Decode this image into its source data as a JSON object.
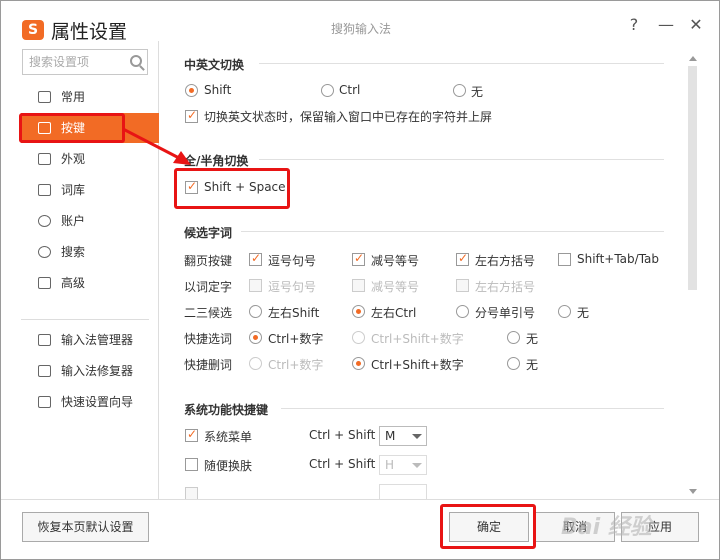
{
  "window": {
    "title": "属性设置",
    "app_name": "搜狗输入法",
    "help_label": "?",
    "minimize_label": "—",
    "close_label": "✕",
    "logo_text": "S"
  },
  "sidebar": {
    "search_placeholder": "搜索设置项",
    "items": [
      {
        "label": "常用",
        "icon": "monitor-icon"
      },
      {
        "label": "按键",
        "icon": "keyboard-icon",
        "active": true
      },
      {
        "label": "外观",
        "icon": "shirt-icon"
      },
      {
        "label": "词库",
        "icon": "dictionary-icon"
      },
      {
        "label": "账户",
        "icon": "user-icon"
      },
      {
        "label": "搜索",
        "icon": "search-icon"
      },
      {
        "label": "高级",
        "icon": "advanced-icon"
      }
    ],
    "tools": [
      {
        "label": "输入法管理器",
        "icon": "manager-icon"
      },
      {
        "label": "输入法修复器",
        "icon": "repair-icon"
      },
      {
        "label": "快速设置向导",
        "icon": "flag-icon"
      }
    ]
  },
  "main": {
    "cn_en_switch": {
      "title": "中英文切换",
      "options": [
        "Shift",
        "Ctrl",
        "无"
      ],
      "selected": "Shift",
      "keep_label": "切换英文状态时，保留输入窗口中已存在的字符并上屏"
    },
    "fullhalf": {
      "title": "全/半角切换",
      "shortcut_label": "Shift + Space"
    },
    "candidate": {
      "title": "候选字词",
      "rows": [
        {
          "label": "翻页按键",
          "items": [
            "逗号句号",
            "减号等号",
            "左右方括号",
            "Shift+Tab/Tab"
          ]
        },
        {
          "label": "以词定字",
          "items": [
            "逗号句号",
            "减号等号",
            "左右方括号"
          ]
        },
        {
          "label": "二三候选",
          "items": [
            "左右Shift",
            "左右Ctrl",
            "分号单引号",
            "无"
          ]
        },
        {
          "label": "快捷选词",
          "items": [
            "Ctrl+数字",
            "Ctrl+Shift+数字",
            "无"
          ]
        },
        {
          "label": "快捷删词",
          "items": [
            "Ctrl+数字",
            "Ctrl+Shift+数字",
            "无"
          ]
        }
      ]
    },
    "sys_shortcut": {
      "title": "系统功能快捷键",
      "rows": [
        {
          "label": "系统菜单",
          "combo": "Ctrl + Shift +",
          "key": "M"
        },
        {
          "label": "随便换肤",
          "combo": "Ctrl + Shift +",
          "key": "H"
        }
      ]
    }
  },
  "footer": {
    "restore_label": "恢复本页默认设置",
    "ok_label": "确定",
    "cancel_label": "取消",
    "apply_label": "应用"
  },
  "watermark": "Bai 经验"
}
